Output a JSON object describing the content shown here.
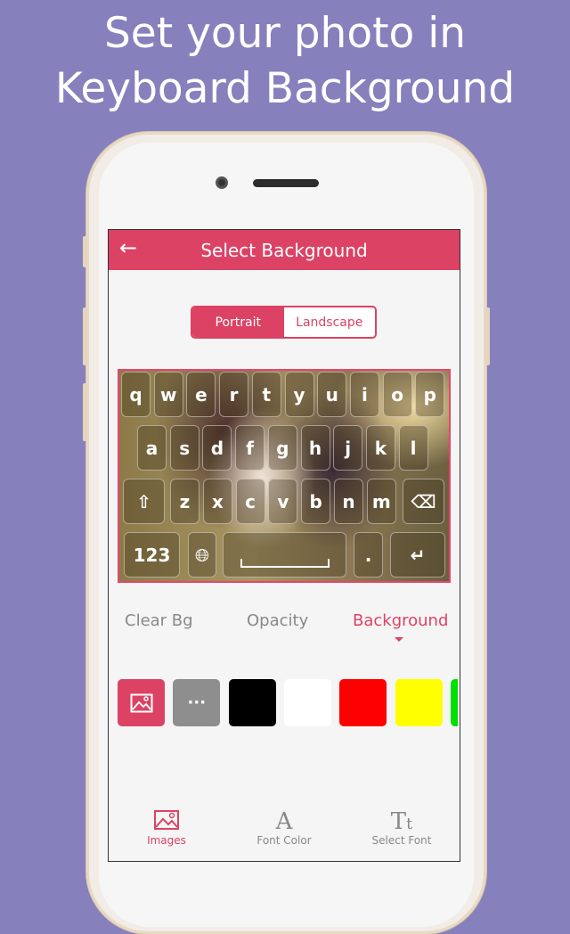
{
  "promo": {
    "line1": "Set your photo in",
    "line2": "Keyboard Background"
  },
  "appbar": {
    "title": "Select Background",
    "back_icon": "arrow-left-icon"
  },
  "orientation": {
    "options": [
      "Portrait",
      "Landscape"
    ],
    "selected": "Portrait"
  },
  "keyboard": {
    "row1": [
      "q",
      "w",
      "e",
      "r",
      "t",
      "y",
      "u",
      "i",
      "o",
      "p"
    ],
    "row2": [
      "a",
      "s",
      "d",
      "f",
      "g",
      "h",
      "j",
      "k",
      "l"
    ],
    "row3": [
      "z",
      "x",
      "c",
      "v",
      "b",
      "n",
      "m"
    ],
    "numbers_key": "123",
    "period_key": ".",
    "icons": [
      "shift-icon",
      "backspace-icon",
      "globe-icon",
      "space-icon",
      "enter-icon"
    ]
  },
  "options_tabs": {
    "items": [
      "Clear Bg",
      "Opacity",
      "Background"
    ],
    "selected": "Background"
  },
  "swatches": [
    "#dc4264",
    "#8e8e8e",
    "#000000",
    "#ffffff",
    "#ff0000",
    "#ffff00",
    "#00e000"
  ],
  "bottom_nav": {
    "items": [
      {
        "label": "Images",
        "icon": "image-icon"
      },
      {
        "label": "Font Color",
        "icon": "font-color-icon"
      },
      {
        "label": "Select Font",
        "icon": "font-icon"
      }
    ],
    "selected": "Images"
  },
  "colors": {
    "accent": "#dc4264",
    "background": "#8680bd"
  }
}
